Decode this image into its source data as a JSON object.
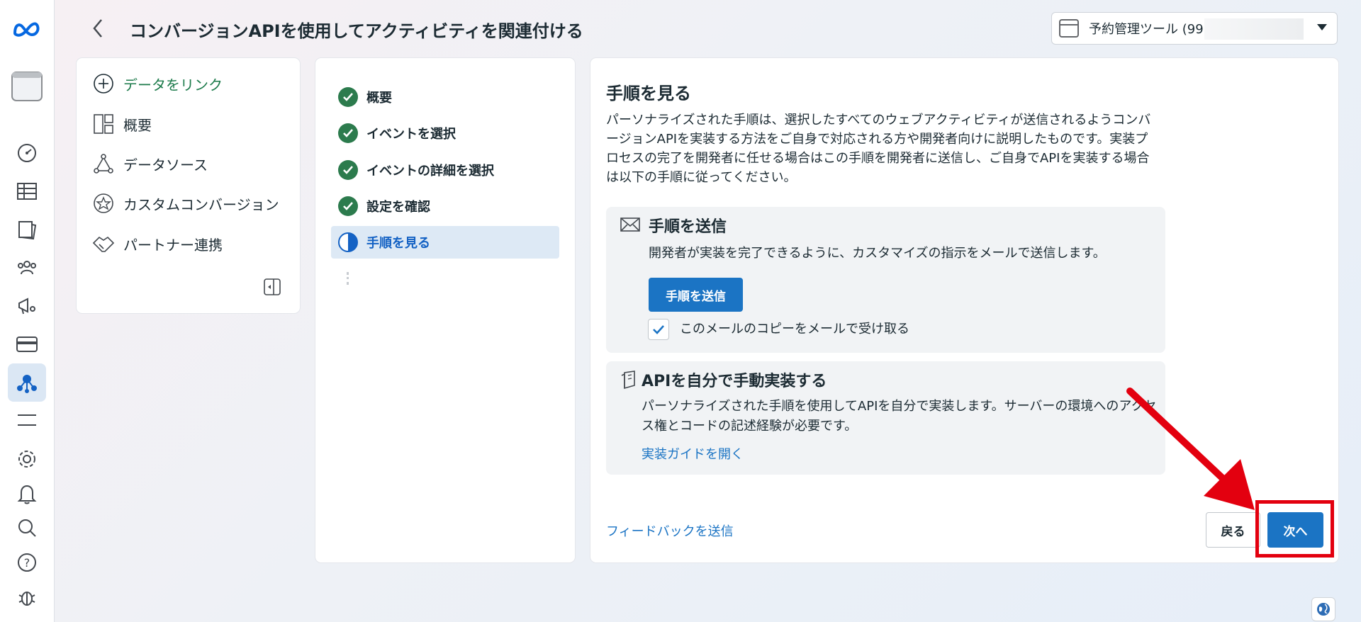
{
  "header": {
    "title": "コンバージョンAPIを使用してアクティビティを関連付ける",
    "account_label": "予約管理ツール (99"
  },
  "nav": {
    "link_data": "データをリンク",
    "items": [
      {
        "label": "概要",
        "icon": "layout-icon"
      },
      {
        "label": "データソース",
        "icon": "nodes-icon"
      },
      {
        "label": "カスタムコンバージョン",
        "icon": "star-icon"
      },
      {
        "label": "パートナー連携",
        "icon": "handshake-icon"
      }
    ]
  },
  "steps": [
    {
      "label": "概要",
      "status": "done"
    },
    {
      "label": "イベントを選択",
      "status": "done"
    },
    {
      "label": "イベントの詳細を選択",
      "status": "done"
    },
    {
      "label": "設定を確認",
      "status": "done"
    },
    {
      "label": "手順を見る",
      "status": "current"
    }
  ],
  "main": {
    "title": "手順を見る",
    "description": "パーソナライズされた手順は、選択したすべてのウェブアクティビティが送信されるようコンバージョンAPIを実装する方法をご自身で対応される方や開発者向けに説明したものです。実装プロセスの完了を開発者に任せる場合はこの手順を開発者に送信し、ご自身でAPIを実装する場合は以下の手順に従ってください。",
    "send_section": {
      "title": "手順を送信",
      "text": "開発者が実装を完了できるように、カスタマイズの指示をメールで送信します。",
      "button": "手順を送信",
      "checkbox_label": "このメールのコピーをメールで受け取る",
      "checkbox_checked": true
    },
    "manual_section": {
      "title": "APIを自分で手動実装する",
      "text": "パーソナライズされた手順を使用してAPIを自分で実装します。サーバーの環境へのアクセス権とコードの記述経験が必要です。",
      "link": "実装ガイドを開く"
    },
    "feedback_link": "フィードバックを送信",
    "back_button": "戻る",
    "next_button": "次へ"
  },
  "colors": {
    "primary": "#1b74c4",
    "success": "#2c7b4d",
    "highlight": "#e3000f"
  }
}
